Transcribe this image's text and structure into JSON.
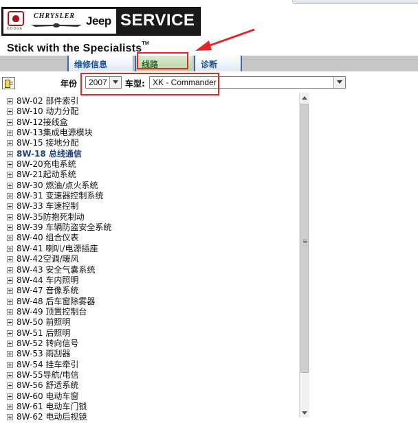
{
  "header": {
    "brands": {
      "dodge": "DODGE",
      "chrysler": "CHRYSLER",
      "jeep": "Jeep"
    },
    "service_label": "SERVICE",
    "slogan": "Stick with the Specialists",
    "trademark": "TM"
  },
  "tabs": [
    {
      "label": "维修信息"
    },
    {
      "label": "线路"
    },
    {
      "label": "诊断"
    }
  ],
  "filters": {
    "year_label": "年份",
    "year_value": "2007",
    "model_label": "车型:",
    "model_value": "XK - Commander"
  },
  "tree": {
    "items": [
      "8W-02 部件索引",
      "8W-10 动力分配",
      "8W-12接线盒",
      "8W-13集成电源模块",
      "8W-15 接地分配",
      "8W-18 总线通信",
      "8W-20充电系统",
      "8W-21起动系统",
      "8W-30 燃油/点火系统",
      "8W-31 变速器控制系统",
      "8W-33 车速控制",
      "8W-35防抱死制动",
      "8W-39 车辆防盗安全系统",
      "8W-40 组合仪表",
      "8W-41 喇叭/电源插座",
      "8W-42空调/暖风",
      "8W-43 安全气囊系统",
      "8W-44 车内照明",
      "8W-47 音像系统",
      "8W-48 后车窗除雾器",
      "8W-49 顶置控制台",
      "8W-50 前照明",
      "8W-51 后照明",
      "8W-52 转向信号",
      "8W-53 雨刮器",
      "8W-54 挂车牵引",
      "8W-55导航/电信",
      "8W-56 舒适系统",
      "8W-60 电动车窗",
      "8W-61 电动车门锁",
      "8W-62 电动后视镜"
    ],
    "selected": "8W-18 总线通信"
  },
  "colors": {
    "annotation": "#e2272b",
    "tab_text": "#1a4fa0",
    "active_tab": "#b7d3a6",
    "tab_bar": "#c6c6c6"
  }
}
